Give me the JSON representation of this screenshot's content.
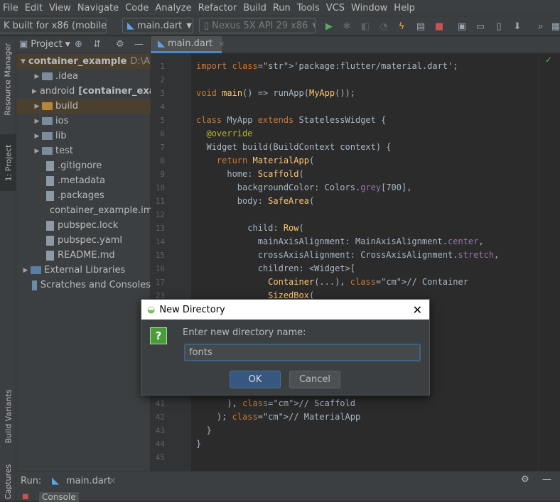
{
  "menu": [
    "File",
    "Edit",
    "View",
    "Navigate",
    "Code",
    "Analyze",
    "Refactor",
    "Build",
    "Run",
    "Tools",
    "VCS",
    "Window",
    "Help"
  ],
  "toolbar": {
    "config_combo": "K built for x86 (mobile)",
    "run_config": "main.dart",
    "device": "Nexus 5X API 29 x86"
  },
  "left_strip": {
    "resource_manager": "Resource Manager",
    "project": "1: Project",
    "build_variants": "Build Variants",
    "captures": "Captures"
  },
  "project_panel": {
    "title": "Project"
  },
  "tree": [
    {
      "label": "container_example",
      "extra": "D:\\An",
      "type": "root"
    },
    {
      "label": ".idea",
      "type": "folder"
    },
    {
      "label": "android",
      "extra": "[container_exa",
      "type": "folder"
    },
    {
      "label": "build",
      "type": "folder-orange"
    },
    {
      "label": "ios",
      "type": "folder"
    },
    {
      "label": "lib",
      "type": "folder"
    },
    {
      "label": "test",
      "type": "folder"
    },
    {
      "label": ".gitignore",
      "type": "file"
    },
    {
      "label": ".metadata",
      "type": "file"
    },
    {
      "label": ".packages",
      "type": "file"
    },
    {
      "label": "container_example.iml",
      "type": "file"
    },
    {
      "label": "pubspec.lock",
      "type": "file"
    },
    {
      "label": "pubspec.yaml",
      "type": "file"
    },
    {
      "label": "README.md",
      "type": "file"
    },
    {
      "label": "External Libraries",
      "type": "lib"
    },
    {
      "label": "Scratches and Consoles",
      "type": "scratch"
    }
  ],
  "editor_tab": "main.dart",
  "line_numbers": [
    "1",
    "2",
    "3",
    "4",
    "5",
    "6",
    "7",
    "8",
    "9",
    "10",
    "11",
    "12",
    "13",
    "14",
    "15",
    "16",
    "17",
    "23",
    "41",
    "42",
    "43",
    "44",
    "45"
  ],
  "code_lines": [
    "import 'package:flutter/material.dart';",
    "",
    "void main() => runApp(MyApp());",
    "",
    "class MyApp extends StatelessWidget {",
    "  @override",
    "  Widget build(BuildContext context) {",
    "    return MaterialApp(",
    "      home: Scaffold(",
    "        backgroundColor: Colors.grey[700],",
    "        body: SafeArea(",
    "",
    "          child: Row(",
    "            mainAxisAlignment: MainAxisAlignment.center,",
    "            crossAxisAlignment: CrossAxisAlignment.stretch,",
    "            children: <Widget>[",
    "              Container(...), // Container",
    "              SizedBox(",
    "      ), // Scaffold",
    "    ); // MaterialApp",
    "  }",
    "}",
    ""
  ],
  "bottom": {
    "run_label": "Run:",
    "run_tab": "main.dart",
    "console": "Console"
  },
  "dialog": {
    "title": "New Directory",
    "prompt": "Enter new directory name:",
    "value": "fonts",
    "ok": "OK",
    "cancel": "Cancel"
  }
}
